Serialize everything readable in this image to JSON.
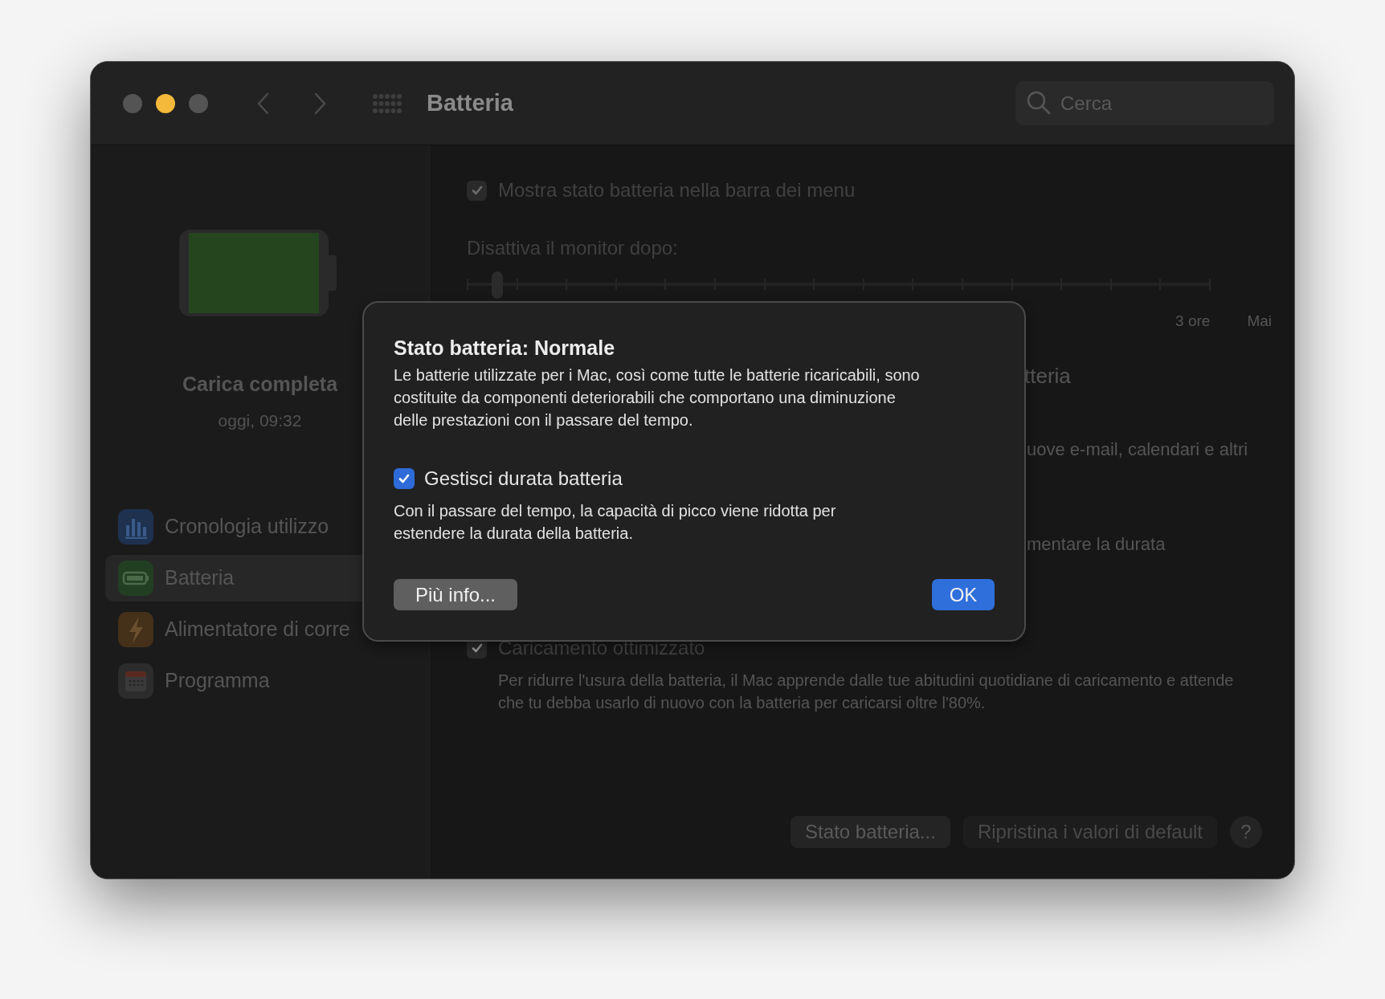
{
  "window": {
    "title": "Batteria"
  },
  "search": {
    "placeholder": "Cerca"
  },
  "battery": {
    "level": 1,
    "status": "Carica completa",
    "time": "oggi, 09:32"
  },
  "sidebar": {
    "items": [
      {
        "kind": "history",
        "label": "Cronologia utilizzo",
        "selected": false
      },
      {
        "kind": "battery",
        "label": "Batteria",
        "selected": true
      },
      {
        "kind": "power",
        "label": "Alimentatore di corre",
        "selected": false
      },
      {
        "kind": "schedule",
        "label": "Programma",
        "selected": false
      }
    ]
  },
  "settings": {
    "menu_bar_status": {
      "label": "Mostra stato batteria nella barra dei menu",
      "checked": true
    },
    "display_off": {
      "label": "Disattiva il monitor dopo:",
      "level": 0.04,
      "tick_labels": [
        "3 ore",
        "Mai"
      ]
    },
    "partially_hidden": [
      "tteria",
      "uove e-mail, calendari e altri",
      "mentare la durata"
    ],
    "optimized_charging": {
      "label": "Caricamento ottimizzato",
      "checked": true,
      "description": "Per ridurre l'usura della batteria, il Mac apprende dalle tue abitudini quotidiane di caricamento e attende che tu debba usarlo di nuovo con la batteria per caricarsi oltre l'80%."
    }
  },
  "buttons": [
    {
      "label": "Stato batteria...",
      "disabled": false
    },
    {
      "label": "Ripristina i valori di default",
      "disabled": true
    }
  ],
  "help": "?",
  "dialog": {
    "title": "Stato batteria: Normale",
    "body": "Le batterie utilizzate per i Mac, così come tutte le batterie ricaricabili, sono costituite da componenti deteriorabili che comportano una diminuzione delle prestazioni con il passare del tempo.",
    "option": {
      "label": "Gestisci durata batteria",
      "checked": true
    },
    "option_description": "Con il passare del tempo, la capacità di picco viene ridotta per estendere la durata della batteria.",
    "buttons": [
      {
        "label": "Più info...",
        "kind": "secondary"
      },
      {
        "label": "OK",
        "kind": "default"
      }
    ]
  }
}
